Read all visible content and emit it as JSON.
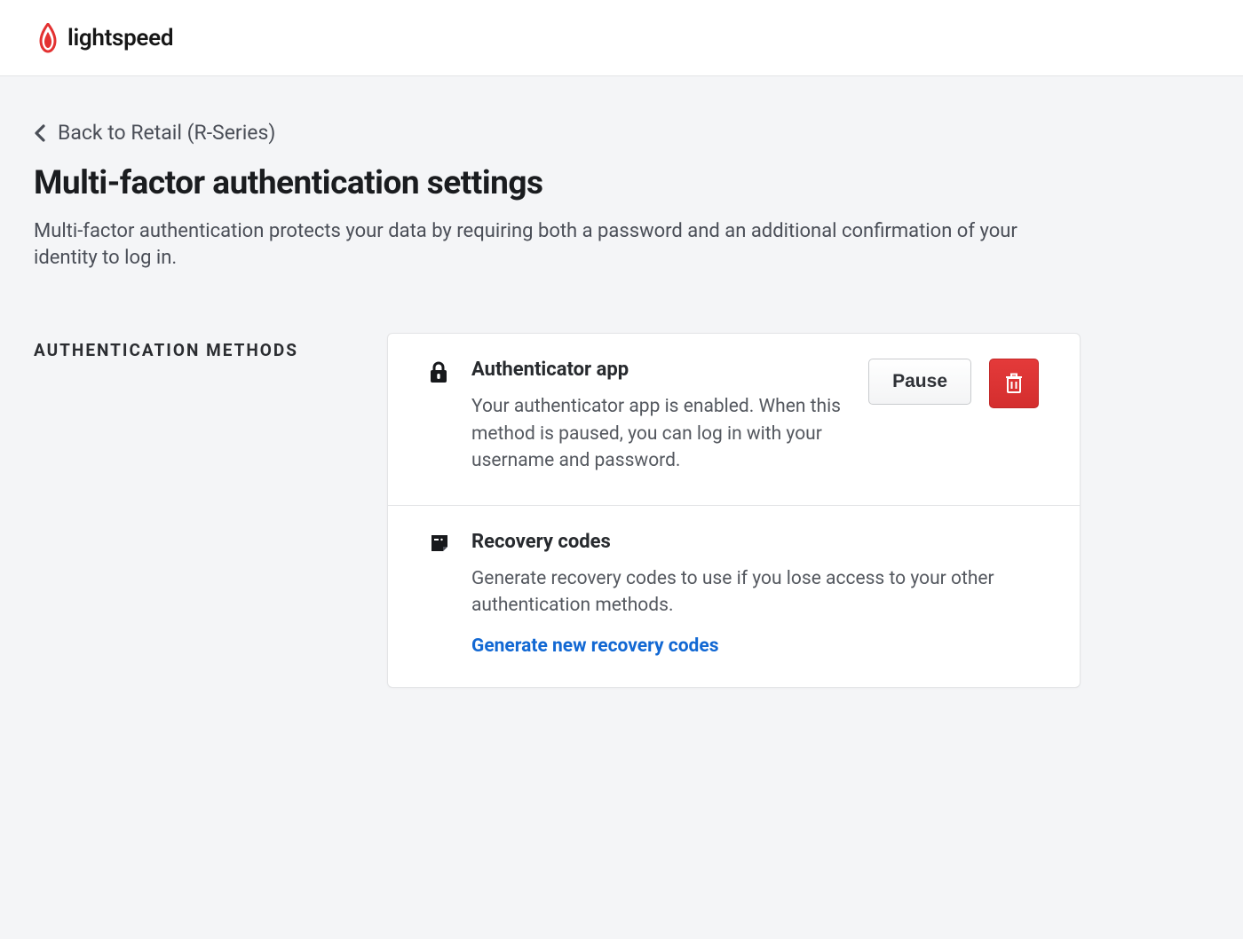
{
  "brand": {
    "name": "lightspeed"
  },
  "nav": {
    "back_label": "Back to Retail (R-Series)"
  },
  "page": {
    "title": "Multi-factor authentication settings",
    "description": "Multi-factor authentication protects your data by requiring both a password and an additional confirmation of your identity to log in."
  },
  "section": {
    "label": "AUTHENTICATION METHODS"
  },
  "methods": {
    "authenticator": {
      "title": "Authenticator app",
      "description": "Your authenticator app is enabled. When this method is paused, you can log in with your username and password.",
      "pause_label": "Pause"
    },
    "recovery": {
      "title": "Recovery codes",
      "description": "Generate recovery codes to use if you lose access to your other authentication methods.",
      "generate_label": "Generate new recovery codes"
    }
  },
  "colors": {
    "brand_red": "#e33131",
    "link_blue": "#1268d3"
  }
}
